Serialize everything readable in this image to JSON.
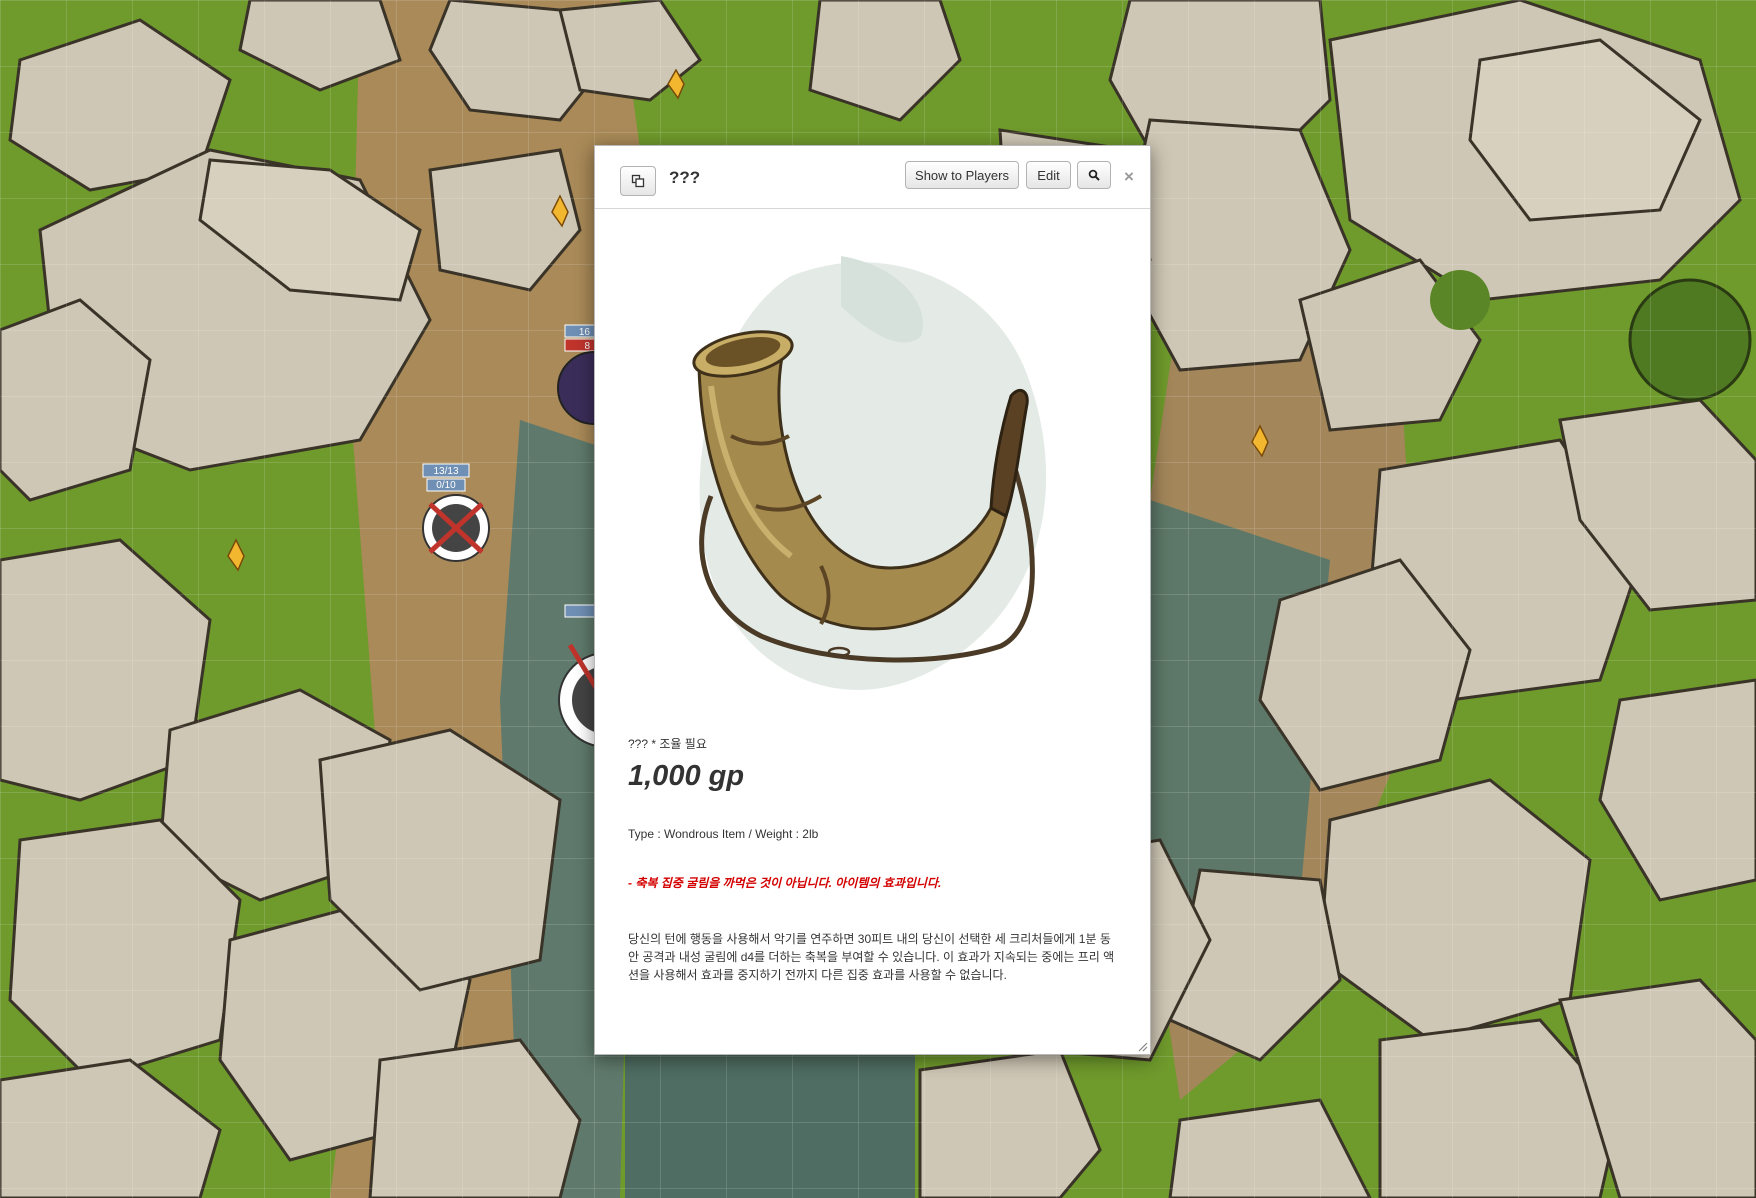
{
  "handout": {
    "title": "???",
    "buttons": {
      "show_to_players": "Show to Players",
      "edit": "Edit"
    },
    "close_label": "×",
    "item": {
      "subtitle": "??? * 조율 필요",
      "price": "1,000 gp",
      "type_line": "Type : Wondrous Item / Weight : 2lb",
      "warning": "- 축복 집중 굴림을 까먹은 것이 아닙니다. 아이템의 효과입니다.",
      "description": "당신의 턴에 행동을 사용해서 악기를 연주하면 30피트 내의 당신이 선택한 세 크리처들에게 1분 동안 공격과 내성 굴림에 d4를 더하는 축복을 부여할 수 있습니다. 이 효과가 지속되는 중에는 프리 액션을 사용해서 효과를 중지하기 전까지 다른 집중 효과를 사용할 수 없습니다."
    }
  },
  "tokens": [
    {
      "hp": "13/13",
      "sub": "0/10"
    },
    {
      "hp": "16",
      "sub": "8"
    }
  ],
  "colors": {
    "grass": "#6f9a2c",
    "dirt": "#a98a58",
    "rock": "#cfc7b5",
    "water": "#5f7a6c",
    "warning_red": "#d40000"
  },
  "icons": [
    "popout-icon",
    "search-icon",
    "close-icon",
    "resize-grip-icon",
    "drinking-horn-image"
  ]
}
